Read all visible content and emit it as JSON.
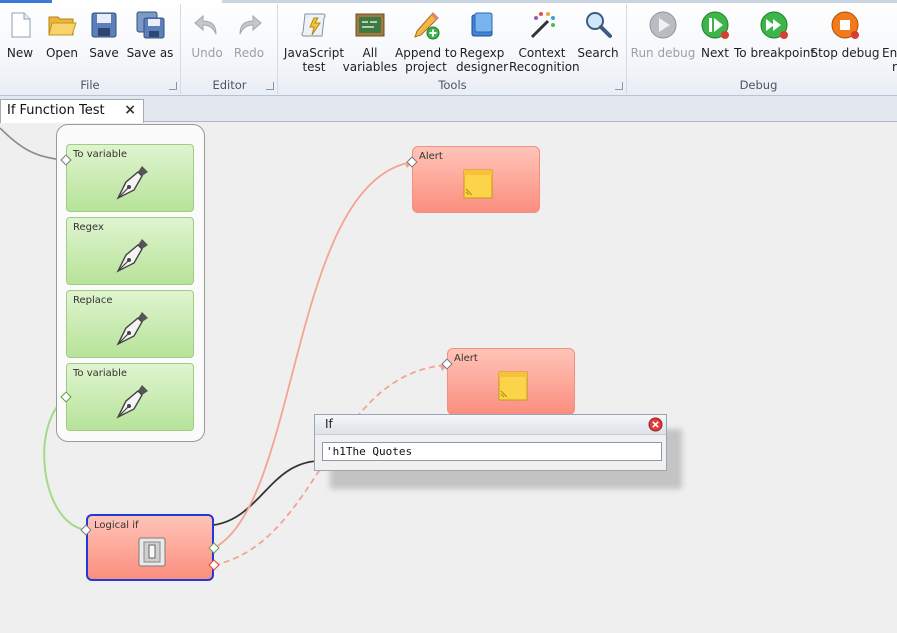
{
  "ribbon": {
    "groups": {
      "file": "File",
      "editor": "Editor",
      "tools": "Tools",
      "debug": "Debug"
    },
    "buttons": {
      "new": "New",
      "open": "Open",
      "save": "Save",
      "save_as": "Save as",
      "undo": "Undo",
      "redo": "Redo",
      "js_test_1": "JavaScript",
      "js_test_2": "test",
      "all_vars_1": "All",
      "all_vars_2": "variables",
      "append_1": "Append to",
      "append_2": "project",
      "regexp_1": "Regexp",
      "regexp_2": "designer",
      "context_1": "Context",
      "context_2": "Recognition",
      "search": "Search",
      "run_debug": "Run debug",
      "next": "Next",
      "to_breakpoint": "To breakpoint",
      "stop_debug": "Stop debug",
      "enter_partial_1": "Ent",
      "enter_partial_2": "r"
    }
  },
  "tabs": {
    "active": "If Function Test",
    "close_glyph": "×"
  },
  "nodes": {
    "to_variable_1": "To variable",
    "regex": "Regex",
    "replace": "Replace",
    "to_variable_2": "To variable",
    "logical_if": "Logical if",
    "alert_1": "Alert",
    "alert_2": "Alert"
  },
  "if_dialog": {
    "title": "If",
    "value": "'h1The Quotes"
  },
  "colors": {
    "green_node": "#b7e39a",
    "red_node": "#fb8e7e",
    "true_wire": "#f5a898",
    "false_wire": "#f5a898",
    "selected_border": "#1f3bd6"
  }
}
